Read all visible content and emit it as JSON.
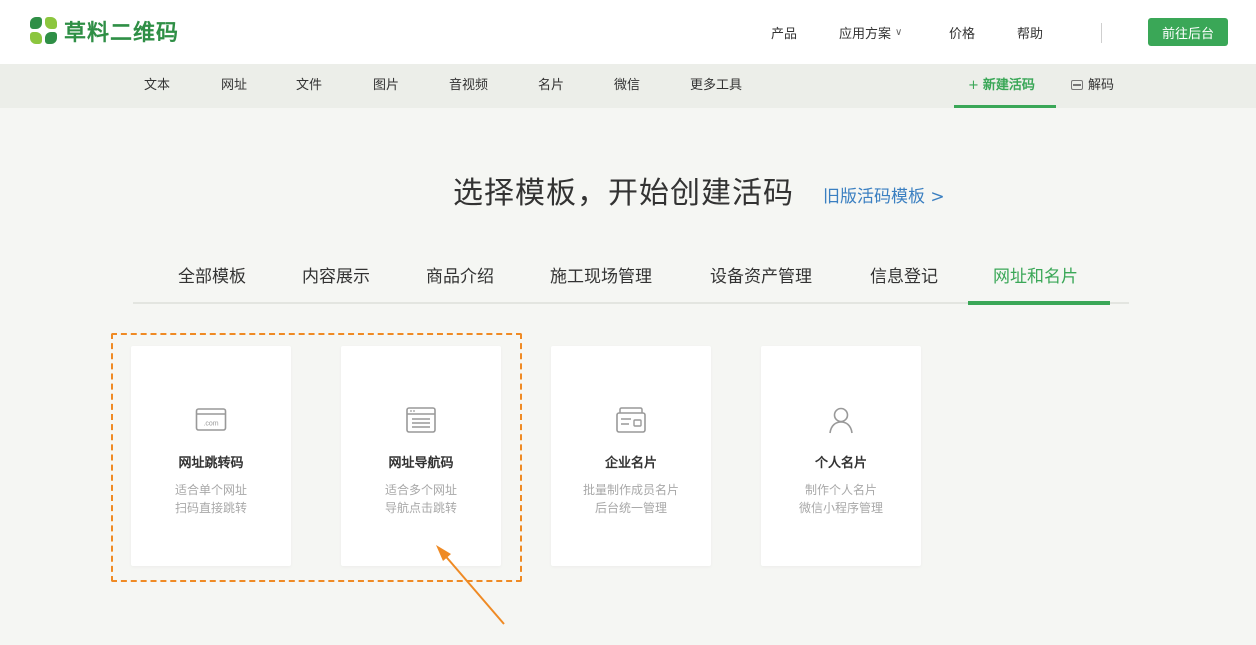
{
  "header": {
    "logo_text": "草料二维码",
    "nav": {
      "product": "产品",
      "solutions": "应用方案",
      "pricing": "价格",
      "help": "帮助"
    },
    "backend_button": "前往后台"
  },
  "subnav": {
    "items": [
      "文本",
      "网址",
      "文件",
      "图片",
      "音视频",
      "名片",
      "微信",
      "更多工具"
    ],
    "new_code": "新建活码",
    "decode": "解码"
  },
  "hero": {
    "title": "选择模板，开始创建活码",
    "old_link": "旧版活码模板 >"
  },
  "tabs": [
    "全部模板",
    "内容展示",
    "商品介绍",
    "施工现场管理",
    "设备资产管理",
    "信息登记",
    "网址和名片"
  ],
  "active_tab": "网址和名片",
  "cards": [
    {
      "title": "网址跳转码",
      "desc1": "适合单个网址",
      "desc2": "扫码直接跳转",
      "icon": "url-jump-icon"
    },
    {
      "title": "网址导航码",
      "desc1": "适合多个网址",
      "desc2": "导航点击跳转",
      "icon": "url-nav-icon"
    },
    {
      "title": "企业名片",
      "desc1": "批量制作成员名片",
      "desc2": "后台统一管理",
      "icon": "business-card-icon"
    },
    {
      "title": "个人名片",
      "desc1": "制作个人名片",
      "desc2": "微信小程序管理",
      "icon": "person-icon"
    }
  ],
  "colors": {
    "brand_green": "#3aa757",
    "link_blue": "#3a7fc1",
    "highlight_orange": "#ef8a24"
  }
}
